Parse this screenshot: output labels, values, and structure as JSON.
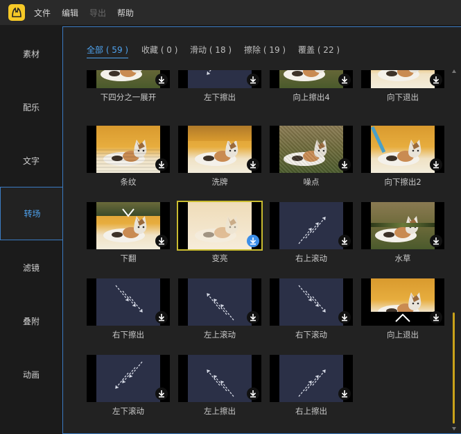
{
  "menubar": {
    "items": [
      {
        "label": "文件",
        "enabled": true
      },
      {
        "label": "编辑",
        "enabled": true
      },
      {
        "label": "导出",
        "enabled": false
      },
      {
        "label": "帮助",
        "enabled": true
      }
    ],
    "logo_icon": "cat-logo-icon",
    "logo_color": "#f6c927"
  },
  "sidebar": {
    "items": [
      {
        "label": "素材"
      },
      {
        "label": "配乐"
      },
      {
        "label": "文字"
      },
      {
        "label": "转场",
        "active": true
      },
      {
        "label": "滤镜"
      },
      {
        "label": "叠附"
      },
      {
        "label": "动画"
      }
    ],
    "accent": "#4fa3ef"
  },
  "tabs": [
    {
      "label": "全部 ( 59 )",
      "active": true
    },
    {
      "label": "收藏 ( 0 )"
    },
    {
      "label": "滑动 ( 18 )"
    },
    {
      "label": "擦除 ( 19 )"
    },
    {
      "label": "覆盖 ( 22 )"
    }
  ],
  "transitions": [
    {
      "label": "下四分之一展开",
      "thumb": "grass-cat-partial"
    },
    {
      "label": "左下擦出",
      "thumb": "navy-arrows-downleft"
    },
    {
      "label": "向上擦出4",
      "thumb": "grass-cat-wipe"
    },
    {
      "label": "向下退出",
      "thumb": "orange-cat-top"
    },
    {
      "label": "条纹",
      "thumb": "orange-cat-stripes"
    },
    {
      "label": "洗牌",
      "thumb": "orange-cat-shuffle"
    },
    {
      "label": "噪点",
      "thumb": "grass-cat-noise"
    },
    {
      "label": "向下擦出2",
      "thumb": "orange-cat-wipe"
    },
    {
      "label": "下翻",
      "thumb": "orange-cat-flip"
    },
    {
      "label": "变亮",
      "thumb": "faded-cat",
      "selected": true
    },
    {
      "label": "右上滚动",
      "thumb": "navy-arrows-upright"
    },
    {
      "label": "水草",
      "thumb": "grass-cat-split"
    },
    {
      "label": "右下擦出",
      "thumb": "navy-arrows-downright"
    },
    {
      "label": "左上滚动",
      "thumb": "navy-arrows-upleft"
    },
    {
      "label": "右下滚动",
      "thumb": "navy-arrows-downright"
    },
    {
      "label": "向上退出",
      "thumb": "orange-cat-bottom"
    },
    {
      "label": "左下滚动",
      "thumb": "navy-arrows-downleft"
    },
    {
      "label": "左上擦出",
      "thumb": "navy-arrows-upleft"
    },
    {
      "label": "右上擦出",
      "thumb": "navy-arrows-upright"
    }
  ],
  "icons": {
    "download": "download-icon",
    "scroll_up": "scroll-up-arrow-icon",
    "scroll_down": "scroll-down-arrow-icon"
  },
  "colors": {
    "selection_outline": "#c9bc2f",
    "download_active": "#3c8ee8",
    "scroll_thumb": "#c9a21a"
  }
}
